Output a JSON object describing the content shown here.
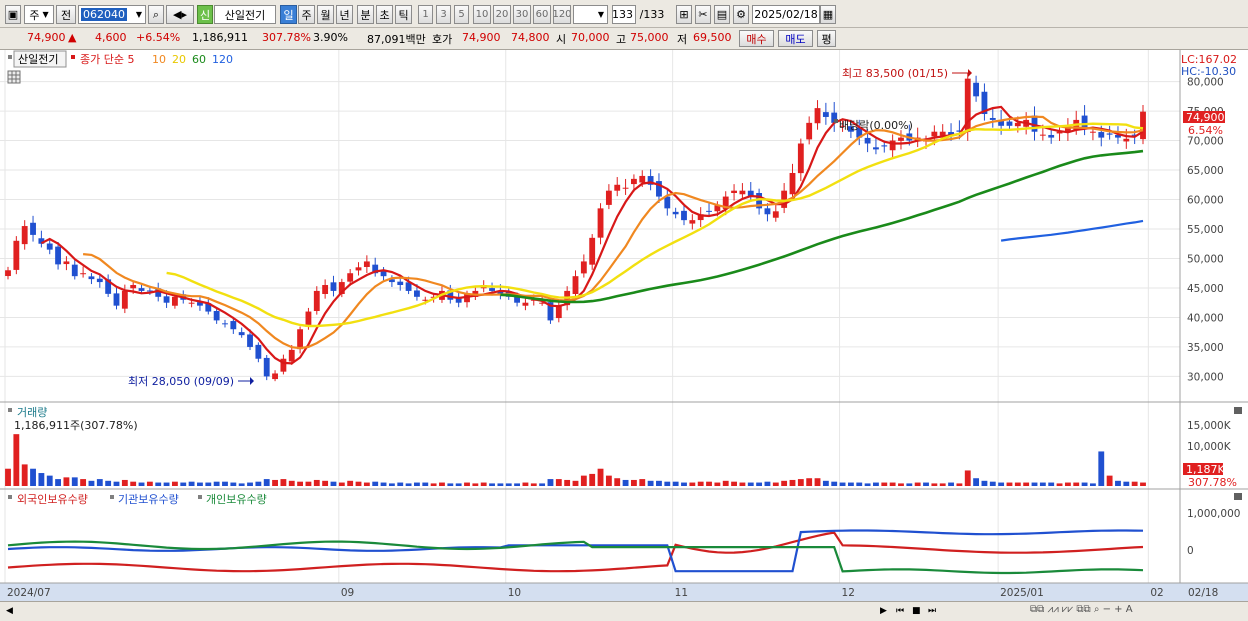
{
  "toolbar": {
    "period_type": "주",
    "prev_label": "전",
    "code": "062040",
    "sin_badge": "신",
    "stock_name": "산일전기",
    "timeframes": [
      "일",
      "주",
      "월",
      "년",
      "분",
      "초",
      "틱"
    ],
    "active_timeframe": "일",
    "intervals": [
      "1",
      "3",
      "5",
      "10",
      "20",
      "30",
      "60",
      "120"
    ],
    "bar_count": "133",
    "bar_total": "/133",
    "date": "2025/02/18"
  },
  "quote": {
    "price": "74,900",
    "change_arrow": "▲",
    "change": "4,600",
    "change_pct": "+6.54%",
    "volume": "1,186,911",
    "volume_ratio": "307.78%",
    "turnover": "3.90%",
    "amount": "87,091백만",
    "hoga_label": "호가",
    "ask": "74,900",
    "bid": "74,800",
    "open_label": "시",
    "open": "70,000",
    "high_label": "고",
    "high": "75,000",
    "low_label": "저",
    "low": "69,500",
    "buy_label": "매수",
    "sell_label": "매도",
    "avg_label": "평"
  },
  "legend": {
    "stock": "산일전기",
    "ma_title": "종가 단순 5",
    "ma_periods": [
      "10",
      "20",
      "60",
      "120"
    ],
    "colors": {
      "ma5": "#d81818",
      "ma10": "#f08820",
      "ma20": "#f2e010",
      "ma60": "#1a8a1a",
      "ma120": "#2060e0"
    }
  },
  "annotations": {
    "high": "최고 83,500 (01/15)",
    "low": "최저 28,050 (09/09)",
    "dividend": "배당락(0.00%)",
    "lc": "LC:167.02",
    "hc": "HC:-10.30",
    "current_price": "74,900",
    "current_pct": "6.54%",
    "volume_title": "거래량",
    "volume_value": "1,186,911주(307.78%)",
    "volume_current": "1,187K",
    "volume_current_pct": "307.78%",
    "holdings_foreign": "외국인보유수량",
    "holdings_inst": "기관보유수량",
    "holdings_indiv": "개인보유수량"
  },
  "x_axis": [
    {
      "label": "2024/07",
      "i": 0
    },
    {
      "label": "09",
      "i": 40
    },
    {
      "label": "10",
      "i": 60
    },
    {
      "label": "11",
      "i": 80
    },
    {
      "label": "12",
      "i": 100
    },
    {
      "label": "2025/01",
      "i": 119
    },
    {
      "label": "02",
      "i": 137
    },
    {
      "label": "02/18",
      "i": 152
    }
  ],
  "chart_data": {
    "type": "candlestick",
    "y_ticks": [
      30000,
      35000,
      40000,
      45000,
      50000,
      55000,
      60000,
      65000,
      70000,
      75000,
      80000
    ],
    "y_range": [
      26000,
      84000
    ],
    "volume_ticks": [
      "10,000K",
      "15,000K"
    ],
    "holding_ticks": [
      "0",
      "1,000,000"
    ],
    "closes": [
      48000,
      53000,
      55500,
      54000,
      52500,
      51500,
      49000,
      49500,
      47000,
      47500,
      46500,
      46000,
      44000,
      42000,
      44500,
      45500,
      44500,
      44500,
      43500,
      42500,
      43500,
      43000,
      42500,
      42000,
      41000,
      39500,
      39000,
      38000,
      37000,
      35000,
      33000,
      30000,
      30500,
      33000,
      34500,
      38000,
      41000,
      44500,
      45500,
      44500,
      46000,
      47500,
      48500,
      49500,
      47500,
      47000,
      46000,
      45500,
      44500,
      43500,
      43000,
      43500,
      44500,
      43000,
      42500,
      44000,
      44500,
      45500,
      44500,
      44000,
      43500,
      42500,
      42500,
      43000,
      42500,
      39500,
      42000,
      44500,
      47000,
      49500,
      53500,
      58500,
      61500,
      62500,
      62000,
      63500,
      64000,
      62500,
      60500,
      58500,
      57500,
      56500,
      56500,
      57500,
      58000,
      59000,
      60500,
      61500,
      61500,
      60500,
      58500,
      57500,
      58000,
      61500,
      64500,
      69500,
      73000,
      75500,
      74000,
      73000,
      72500,
      71500,
      70500,
      69500,
      68500,
      69000,
      70000,
      70500,
      70000,
      70500,
      70000,
      71500,
      71500,
      71000,
      71500,
      80500,
      77500,
      74500,
      73500,
      72500,
      72500,
      73000,
      73500,
      71500,
      71000,
      70500,
      71500,
      72500,
      73500,
      72000,
      71500,
      70500,
      71000,
      70500,
      70300,
      70900,
      74900
    ],
    "volume": [
      2.0,
      6.0,
      2.5,
      2.0,
      1.5,
      1.2,
      0.8,
      1.0,
      1.0,
      0.8,
      0.6,
      0.8,
      0.6,
      0.5,
      0.7,
      0.5,
      0.4,
      0.5,
      0.4,
      0.4,
      0.5,
      0.4,
      0.5,
      0.4,
      0.4,
      0.5,
      0.5,
      0.4,
      0.3,
      0.4,
      0.5,
      0.8,
      0.7,
      0.8,
      0.6,
      0.5,
      0.5,
      0.7,
      0.6,
      0.5,
      0.4,
      0.6,
      0.5,
      0.4,
      0.5,
      0.4,
      0.3,
      0.4,
      0.3,
      0.4,
      0.4,
      0.3,
      0.4,
      0.3,
      0.3,
      0.4,
      0.3,
      0.4,
      0.3,
      0.3,
      0.3,
      0.3,
      0.4,
      0.3,
      0.3,
      0.8,
      0.8,
      0.7,
      0.6,
      1.2,
      1.4,
      2.0,
      1.2,
      0.9,
      0.7,
      0.7,
      0.8,
      0.6,
      0.6,
      0.5,
      0.5,
      0.4,
      0.4,
      0.5,
      0.5,
      0.4,
      0.6,
      0.5,
      0.4,
      0.4,
      0.4,
      0.5,
      0.4,
      0.6,
      0.7,
      0.8,
      0.9,
      0.9,
      0.6,
      0.5,
      0.4,
      0.4,
      0.4,
      0.3,
      0.4,
      0.4,
      0.4,
      0.3,
      0.3,
      0.4,
      0.4,
      0.3,
      0.3,
      0.4,
      0.3,
      1.8,
      0.9,
      0.6,
      0.5,
      0.4,
      0.4,
      0.4,
      0.4,
      0.4,
      0.4,
      0.4,
      0.3,
      0.4,
      0.4,
      0.4,
      0.3,
      4.0,
      1.2,
      0.6,
      0.5,
      0.5,
      0.4,
      0.4,
      0.3,
      0.3,
      0.4,
      1.2
    ]
  }
}
